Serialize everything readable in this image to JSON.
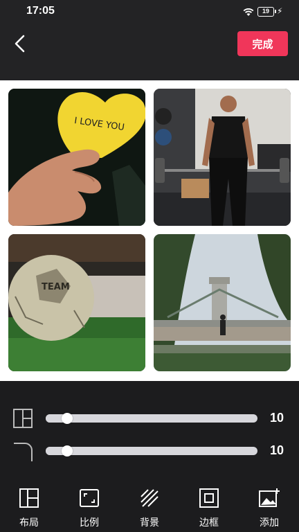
{
  "status_bar": {
    "time": "17:05",
    "battery_level": "19",
    "icons": [
      "wifi-icon",
      "battery-icon",
      "charging-icon"
    ]
  },
  "top_bar": {
    "back_icon": "back-icon",
    "done_label": "完成",
    "accent_color": "#f0365a"
  },
  "collage": {
    "background_color": "#ffffff",
    "cells": [
      {
        "content": "I LOVE YOU"
      },
      {
        "content": ""
      },
      {
        "content": "TEAM"
      },
      {
        "content": ""
      }
    ]
  },
  "sliders": [
    {
      "icon": "layout-spacing-icon",
      "value": "10",
      "fraction": 0.1
    },
    {
      "icon": "corner-radius-icon",
      "value": "10",
      "fraction": 0.1
    }
  ],
  "toolbar": {
    "items": [
      {
        "icon": "layout-icon",
        "label": "布局"
      },
      {
        "icon": "ratio-icon",
        "label": "比例"
      },
      {
        "icon": "background-icon",
        "label": "背景"
      },
      {
        "icon": "border-icon",
        "label": "边框"
      },
      {
        "icon": "add-image-icon",
        "label": "添加"
      }
    ]
  }
}
